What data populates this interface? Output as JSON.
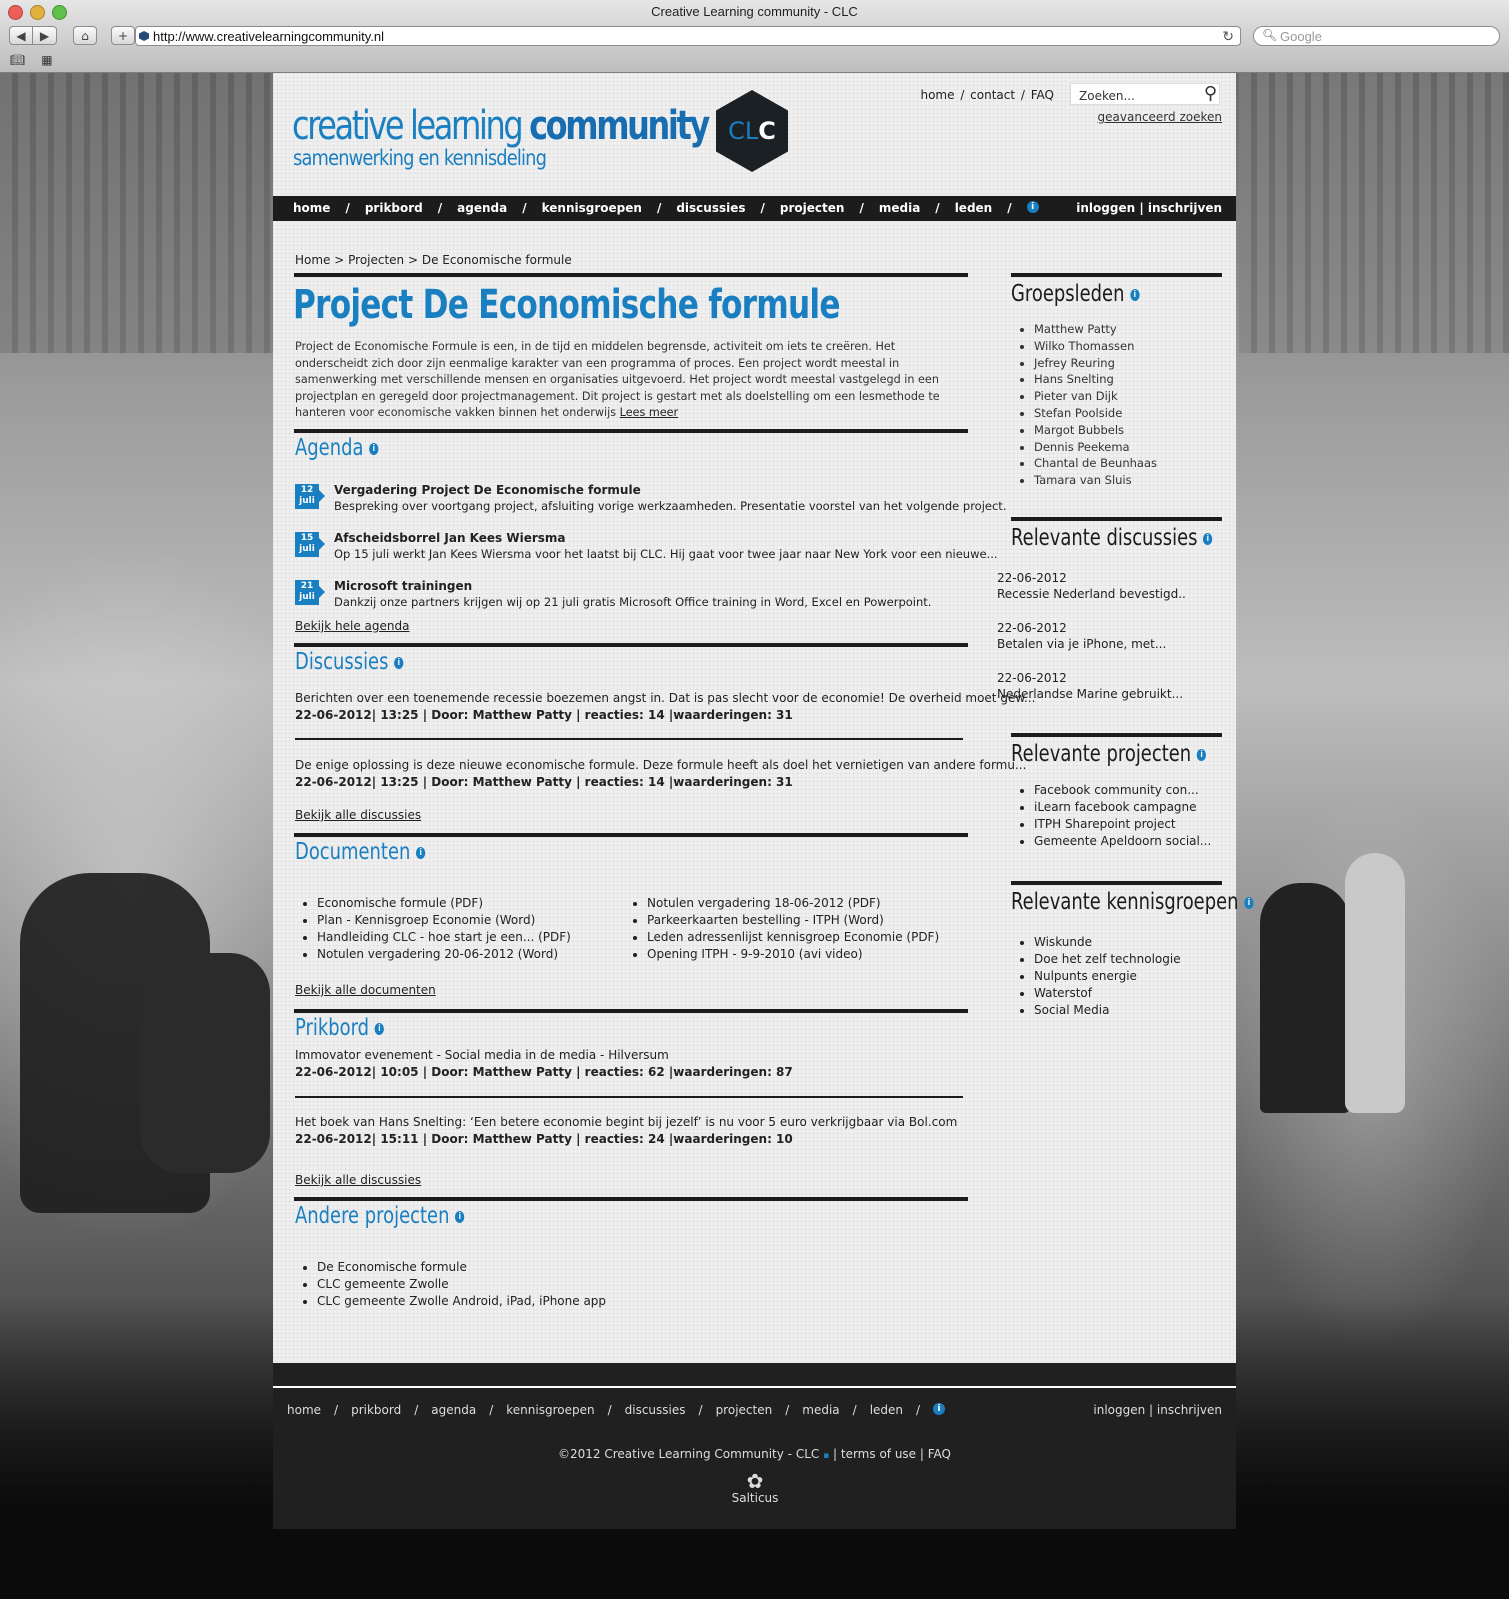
{
  "browser": {
    "window_title": "Creative Learning community - CLC",
    "url": "http://www.creativelearningcommunity.nl",
    "search_placeholder": "Google"
  },
  "header": {
    "top_links": [
      "home",
      "contact",
      "FAQ"
    ],
    "search_placeholder": "Zoeken...",
    "advanced_search": "geavanceerd zoeken",
    "logo_text_plain": "creative learning ",
    "logo_text_bold": "community",
    "logo_subtitle": "samenwerking en kennisdeling",
    "logo_mark_1": "CL",
    "logo_mark_2": "C"
  },
  "nav": {
    "items": [
      "home",
      "prikbord",
      "agenda",
      "kennisgroepen",
      "discussies",
      "projecten",
      "media",
      "leden"
    ],
    "login": "inloggen",
    "register": "inschrijven"
  },
  "breadcrumb": "Home > Projecten > De Economische formule",
  "main": {
    "title": "Project De Economische formule",
    "intro": "Project de Economische Formule is een, in de tijd en middelen begrensde, activiteit om iets te creëren. Het onderscheidt zich door zijn eenmalige karakter van een programma of proces. Een project wordt meestal in samenwerking met verschillende mensen en organisaties uitgevoerd. Het project wordt meestal vastgelegd in een projectplan en geregeld door projectmanagement. Dit project is gestart met als doelstelling om een lesmethode te hanteren voor economische vakken binnen het onderwijs",
    "read_more": "Lees meer",
    "agenda": {
      "heading": "Agenda",
      "events": [
        {
          "day": "12",
          "month": "juli",
          "title": "Vergadering Project De Economische formule",
          "desc": "Bespreking over voortgang project, afsluiting vorige werkzaamheden. Presentatie voorstel van het volgende project."
        },
        {
          "day": "15",
          "month": "juli",
          "title": "Afscheidsborrel Jan Kees Wiersma",
          "desc": "Op 15 juli werkt Jan Kees Wiersma voor het laatst bij CLC. Hij gaat voor twee jaar naar New York voor een nieuwe..."
        },
        {
          "day": "21",
          "month": "juli",
          "title": "Microsoft trainingen",
          "desc": "Dankzij onze partners krijgen wij op 21 juli gratis Microsoft Office training in Word, Excel en Powerpoint."
        }
      ],
      "more": "Bekijk hele agenda"
    },
    "discussies": {
      "heading": "Discussies",
      "posts": [
        {
          "text": "Berichten over een toenemende recessie boezemen angst in. Dat is pas slecht voor de economie! De overheid moet gew...",
          "meta": "22-06-2012| 13:25 | Door: Matthew Patty | reacties: 14 |waarderingen: 31"
        },
        {
          "text": "De enige oplossing is deze nieuwe economische formule. Deze formule heeft als doel het vernietigen van andere formu...",
          "meta": "22-06-2012| 13:25 | Door: Matthew Patty | reacties: 14 |waarderingen: 31"
        }
      ],
      "more": "Bekijk alle discussies"
    },
    "documenten": {
      "heading": "Documenten",
      "col1": [
        "Economische formule (PDF)",
        "Plan - Kennisgroep Economie (Word)",
        "Handleiding CLC - hoe start je een... (PDF)",
        "Notulen vergadering 20-06-2012 (Word)"
      ],
      "col2": [
        "Notulen vergadering 18-06-2012 (PDF)",
        "Parkeerkaarten bestelling - ITPH (Word)",
        "Leden adressenlijst kennisgroep Economie (PDF)",
        "Opening ITPH - 9-9-2010 (avi video)"
      ],
      "more": "Bekijk alle documenten"
    },
    "prikbord": {
      "heading": "Prikbord",
      "posts": [
        {
          "text": "Immovator evenement - Social media in de media - Hilversum",
          "meta": "22-06-2012| 10:05 | Door: Matthew Patty | reacties: 62 |waarderingen: 87"
        },
        {
          "text": "Het boek van Hans Snelting: ‘Een betere economie begint bij jezelf’ is nu voor 5 euro verkrijgbaar via Bol.com",
          "meta": "22-06-2012| 15:11 | Door: Matthew Patty | reacties: 24 |waarderingen: 10"
        }
      ],
      "more": "Bekijk alle discussies"
    },
    "andere": {
      "heading": "Andere projecten",
      "items": [
        "De Economische formule",
        "CLC gemeente Zwolle",
        "CLC gemeente Zwolle Android, iPad, iPhone app"
      ]
    }
  },
  "sidebar": {
    "groepsleden": {
      "heading": "Groepsleden",
      "items": [
        "Matthew Patty",
        "Wilko Thomassen",
        "Jefrey Reuring",
        "Hans Snelting",
        "Pieter van Dijk",
        "Stefan Poolside",
        "Margot Bubbels",
        "Dennis Peekema",
        "Chantal de Beunhaas",
        "Tamara van Sluis"
      ]
    },
    "discussies": {
      "heading": "Relevante discussies",
      "items": [
        {
          "date": "22-06-2012",
          "text": "Recessie Nederland bevestigd.."
        },
        {
          "date": "22-06-2012",
          "text": "Betalen via je iPhone, met..."
        },
        {
          "date": "22-06-2012",
          "text": "Nederlandse Marine gebruikt..."
        }
      ]
    },
    "projecten": {
      "heading": "Relevante projecten",
      "items": [
        "Facebook community con...",
        "iLearn facebook campagne",
        "ITPH Sharepoint project",
        "Gemeente Apeldoorn social..."
      ]
    },
    "kennisgroepen": {
      "heading": "Relevante kennisgroepen",
      "items": [
        "Wiskunde",
        "Doe het zelf technologie",
        "Nulpunts energie",
        "Waterstof",
        "Social Media"
      ]
    }
  },
  "footer": {
    "nav": [
      "home",
      "prikbord",
      "agenda",
      "kennisgroepen",
      "discussies",
      "projecten",
      "media",
      "leden"
    ],
    "login": "inloggen",
    "register": "inschrijven",
    "copyright": "©2012 Creative Learning Community - CLC",
    "terms": "terms of use",
    "faq": "FAQ",
    "brand": "Salticus"
  },
  "colors": {
    "accent": "#1a7fc1",
    "dark": "#1c1c1c"
  }
}
